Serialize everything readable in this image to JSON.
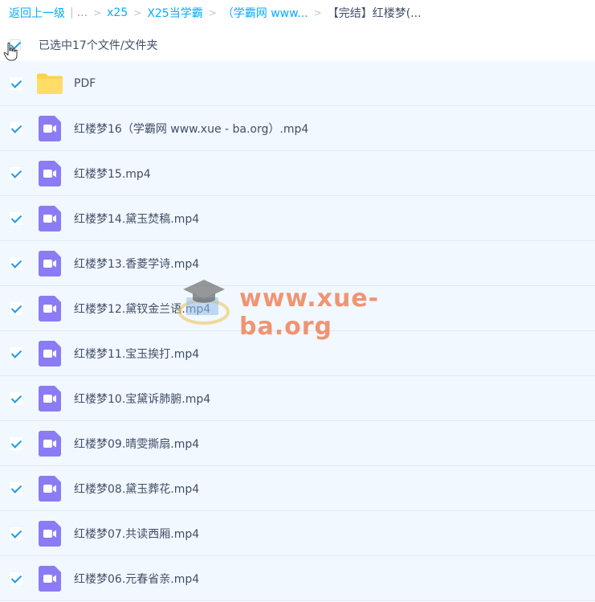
{
  "breadcrumb": {
    "back": "返回上一级",
    "ellipsis": "...",
    "items": [
      "x25",
      "X25当学霸",
      "（学霸网 www...",
      "【完结】红楼梦(..."
    ]
  },
  "selection": {
    "label": "已选中17个文件/文件夹"
  },
  "files": [
    {
      "name": "PDF",
      "type": "folder"
    },
    {
      "name": "红楼梦16（学霸网 www.xue - ba.org）.mp4",
      "type": "video"
    },
    {
      "name": "红楼梦15.mp4",
      "type": "video"
    },
    {
      "name": "红楼梦14.黛玉焚稿.mp4",
      "type": "video"
    },
    {
      "name": "红楼梦13.香菱学诗.mp4",
      "type": "video"
    },
    {
      "name": "红楼梦12.黛钗金兰语.mp4",
      "type": "video"
    },
    {
      "name": "红楼梦11.宝玉挨打.mp4",
      "type": "video"
    },
    {
      "name": "红楼梦10.宝黛诉肺腑.mp4",
      "type": "video"
    },
    {
      "name": "红楼梦09.晴雯撕扇.mp4",
      "type": "video"
    },
    {
      "name": "红楼梦08.黛玉葬花.mp4",
      "type": "video"
    },
    {
      "name": "红楼梦07.共读西厢.mp4",
      "type": "video"
    },
    {
      "name": "红楼梦06.元春省亲.mp4",
      "type": "video"
    }
  ],
  "watermark": {
    "text": "www.xue-ba.org"
  },
  "colors": {
    "accent": "#09aaff",
    "row_bg": "#f1f8ff",
    "video_icon": "#8b7cf6",
    "folder_icon": "#ffd24d",
    "watermark": "#f06e3c"
  }
}
